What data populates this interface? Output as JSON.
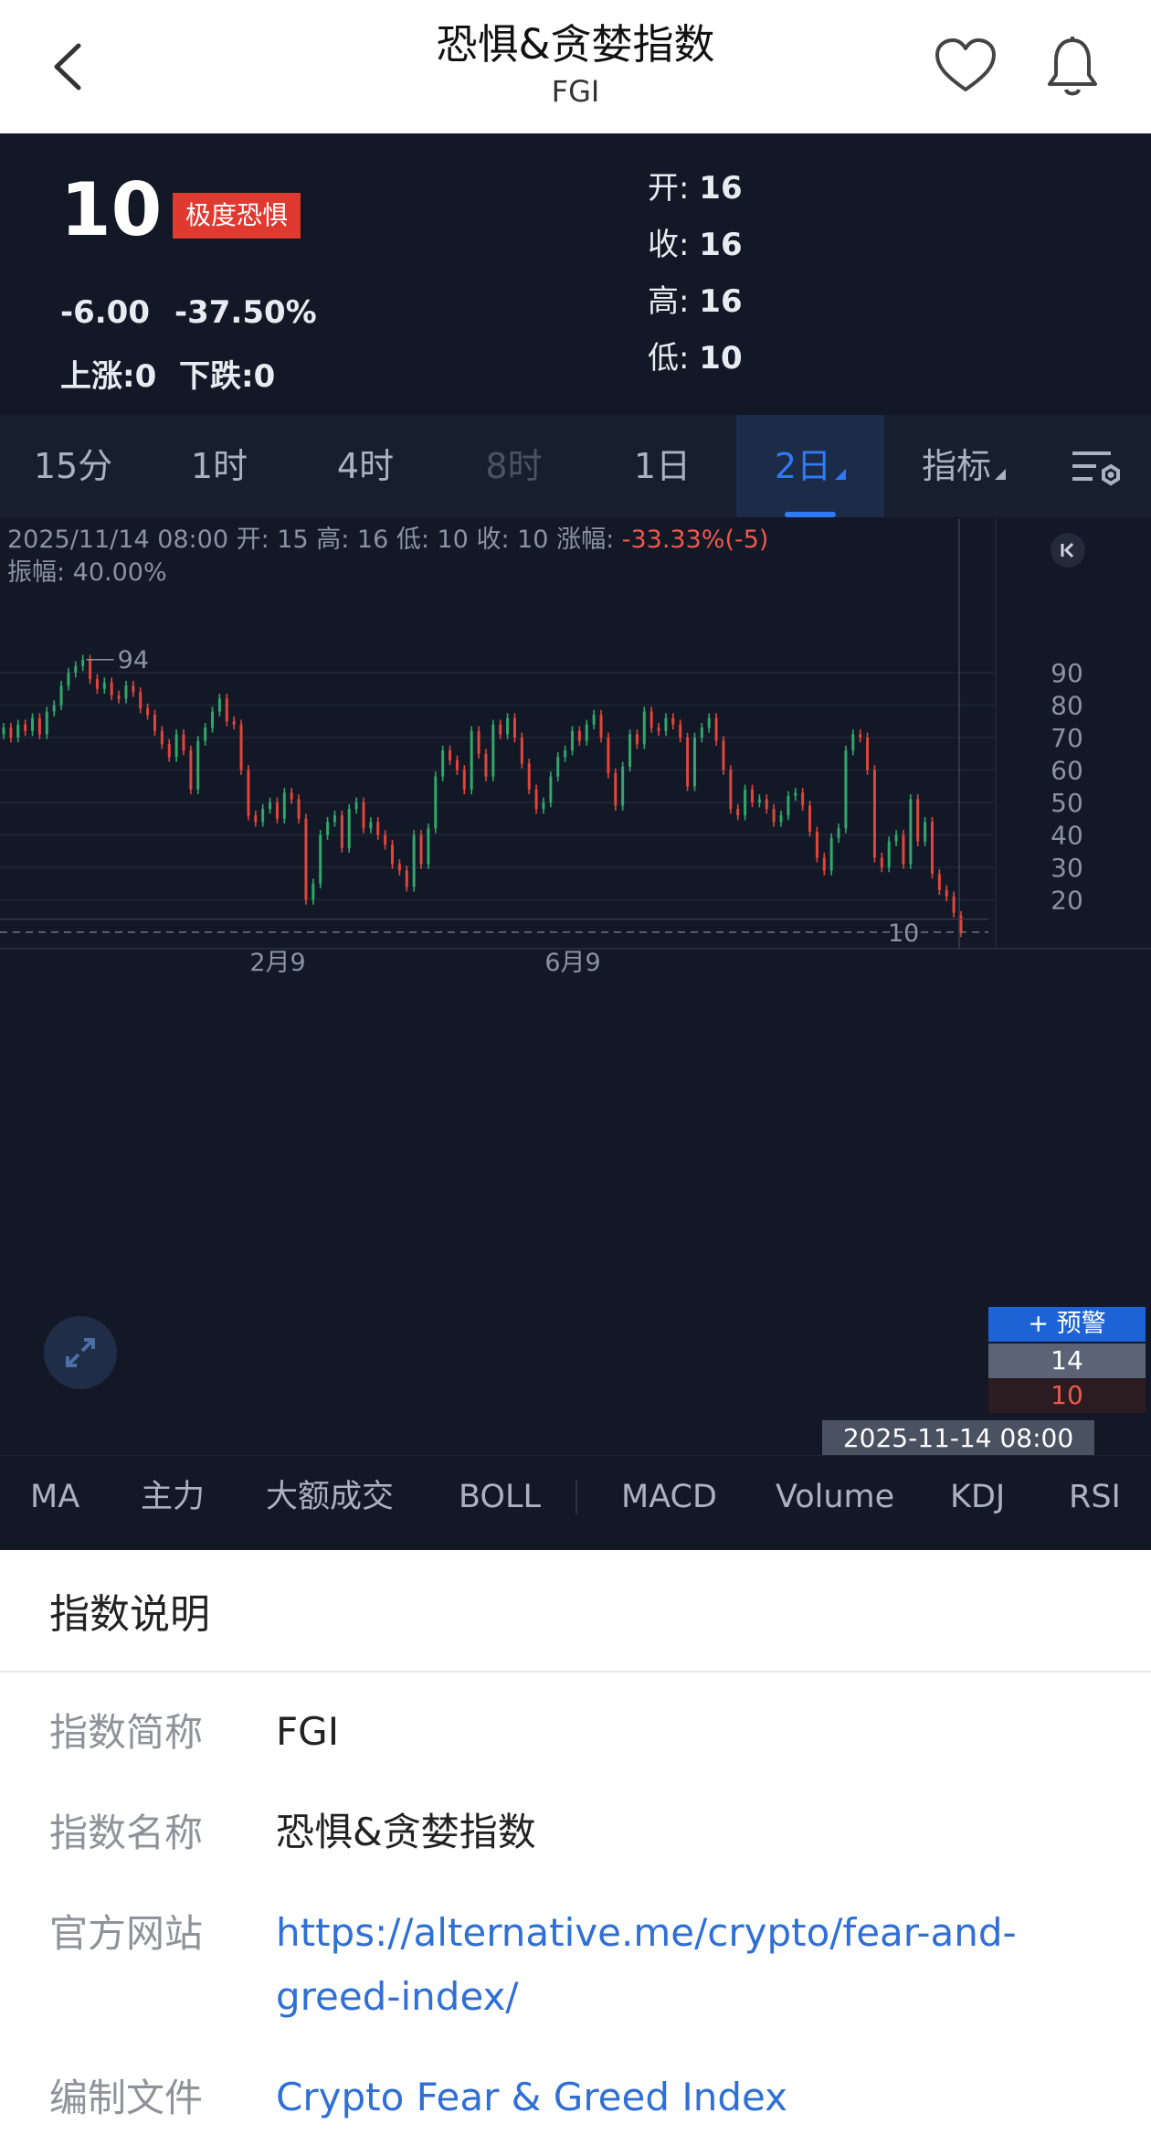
{
  "header": {
    "title": "恐惧&贪婪指数",
    "subtitle": "FGI"
  },
  "summary": {
    "price": "10",
    "badge": "极度恐惧",
    "change": "-6.00",
    "change_pct": "-37.50%",
    "up_label": "上涨:0",
    "down_label": "下跌:0",
    "open_label": "开:",
    "open_value": "16",
    "close_label": "收:",
    "close_value": "16",
    "high_label": "高:",
    "high_value": "16",
    "low_label": "低:",
    "low_value": "10"
  },
  "tabs": [
    {
      "label": "15分"
    },
    {
      "label": "1时"
    },
    {
      "label": "4时"
    },
    {
      "label": "8时"
    },
    {
      "label": "1日"
    },
    {
      "label": "2日"
    },
    {
      "label": "指标"
    }
  ],
  "chart_info": {
    "line1_prefix": "2025/11/14 08:00 开: 15 高: 16 低: 10 收: 10 涨幅: ",
    "line1_change": "-33.33%(-5)",
    "line2": "振幅: 40.00%"
  },
  "chart_labels": {
    "alert": "+ 预警",
    "mark_14": "14",
    "mark_10": "10",
    "crosshair_date": "2025-11-14 08:00"
  },
  "chart_data": {
    "type": "candlestick",
    "y_ticks": [
      "90",
      "80",
      "70",
      "60",
      "50",
      "40",
      "30",
      "20"
    ],
    "x_ticks": [
      "2月9",
      "6月9"
    ],
    "ylim": [
      10,
      94
    ],
    "max_label": "94",
    "min_label": "10",
    "last_close": 10,
    "up_color": "#2fa86a",
    "down_color": "#e0463c",
    "closes": [
      73,
      70,
      74,
      72,
      76,
      71,
      78,
      80,
      86,
      90,
      92,
      94,
      88,
      85,
      87,
      83,
      82,
      86,
      84,
      79,
      77,
      72,
      68,
      64,
      71,
      66,
      54,
      69,
      73,
      78,
      82,
      75,
      74,
      60,
      46,
      44,
      48,
      50,
      45,
      53,
      51,
      45,
      20,
      25,
      40,
      44,
      46,
      36,
      48,
      50,
      42,
      44,
      40,
      37,
      31,
      29,
      24,
      40,
      31,
      42,
      58,
      66,
      63,
      60,
      54,
      72,
      65,
      58,
      74,
      71,
      76,
      70,
      62,
      54,
      48,
      50,
      58,
      64,
      66,
      72,
      69,
      74,
      77,
      70,
      59,
      49,
      61,
      71,
      68,
      78,
      73,
      72,
      76,
      74,
      70,
      55,
      70,
      73,
      76,
      69,
      60,
      48,
      46,
      54,
      50,
      51,
      48,
      44,
      46,
      52,
      53,
      49,
      41,
      33,
      29,
      39,
      42,
      66,
      71,
      70,
      60,
      33,
      30,
      38,
      40,
      31,
      51,
      38,
      44,
      28,
      23,
      21,
      16,
      10
    ],
    "opens": [
      71,
      73,
      70,
      74,
      72,
      76,
      71,
      78,
      80,
      86,
      90,
      92,
      94,
      88,
      85,
      87,
      83,
      82,
      86,
      84,
      79,
      77,
      72,
      68,
      64,
      71,
      66,
      54,
      69,
      73,
      78,
      82,
      75,
      74,
      60,
      46,
      44,
      48,
      50,
      45,
      53,
      51,
      45,
      20,
      25,
      40,
      44,
      46,
      36,
      48,
      50,
      42,
      44,
      40,
      37,
      31,
      29,
      24,
      40,
      31,
      42,
      58,
      66,
      63,
      60,
      54,
      72,
      65,
      58,
      74,
      71,
      76,
      70,
      62,
      54,
      48,
      50,
      58,
      64,
      66,
      72,
      69,
      74,
      77,
      70,
      59,
      49,
      61,
      71,
      68,
      78,
      73,
      72,
      76,
      74,
      70,
      55,
      70,
      73,
      76,
      69,
      60,
      48,
      46,
      54,
      50,
      51,
      48,
      44,
      46,
      52,
      53,
      49,
      41,
      33,
      29,
      39,
      42,
      66,
      71,
      70,
      60,
      33,
      30,
      38,
      40,
      31,
      51,
      38,
      44,
      28,
      23,
      21,
      15
    ]
  },
  "indicators": [
    {
      "label": "MA"
    },
    {
      "label": "主力"
    },
    {
      "label": "大额成交"
    },
    {
      "label": "BOLL"
    },
    {
      "label": "MACD"
    },
    {
      "label": "Volume"
    },
    {
      "label": "KDJ"
    },
    {
      "label": "RSI"
    }
  ],
  "description": {
    "title": "指数说明",
    "rows": [
      {
        "label": "指数简称",
        "value": "FGI"
      },
      {
        "label": "指数名称",
        "value": "恐惧&贪婪指数"
      },
      {
        "label": "官方网站",
        "value": "https://alternative.me/crypto/fear-and-greed-index/",
        "value_line1": "https://alternative.me/crypto/fear-and-",
        "value_line2": "greed-index/"
      },
      {
        "label": "编制文件",
        "value": "Crypto Fear & Greed Index"
      }
    ]
  }
}
